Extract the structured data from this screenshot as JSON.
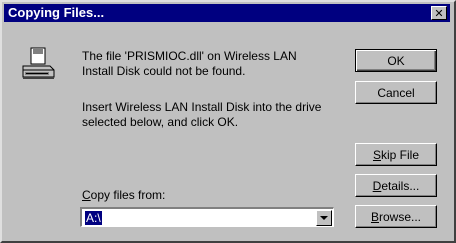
{
  "window": {
    "title": "Copying Files...",
    "close_glyph": "✕"
  },
  "message": {
    "line1": "The file 'PRISMIOC.dll' on Wireless LAN\nInstall Disk could not be found.",
    "line2": "Insert Wireless LAN Install Disk into the drive\nselected below, and click OK."
  },
  "buttons": {
    "ok": "OK",
    "cancel": "Cancel",
    "skip_file": {
      "accel": "S",
      "rest": "kip File"
    },
    "details": {
      "accel": "D",
      "rest": "etails..."
    },
    "browse": {
      "accel": "B",
      "rest": "rowse..."
    }
  },
  "copy_from": {
    "label": {
      "accel": "C",
      "rest": "opy files from:"
    },
    "value": "A:\\"
  },
  "icons": {
    "dialog_icon": "disk-drive-icon",
    "dropdown": "chevron-down-icon"
  },
  "colors": {
    "titlebar": "#000080",
    "face": "#c0c0c0",
    "selection": "#000080"
  }
}
